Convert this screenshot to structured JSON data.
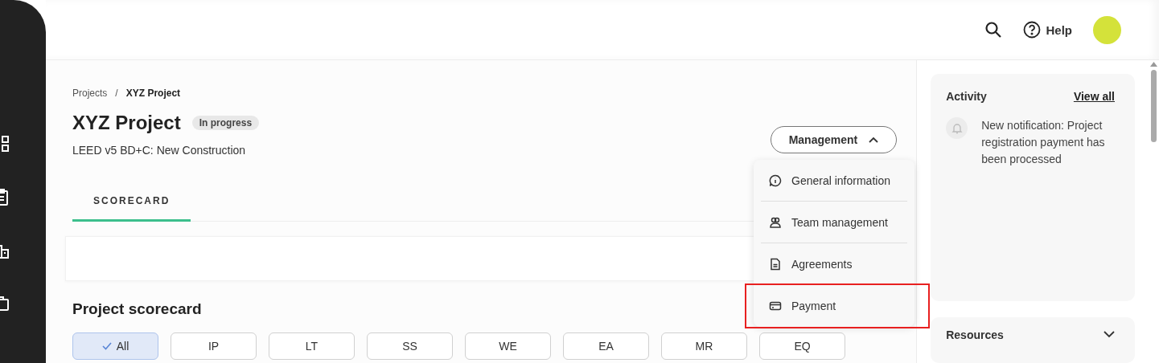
{
  "header": {
    "help": "Help"
  },
  "breadcrumb": [
    {
      "label": "Projects",
      "current": false
    },
    {
      "separator": "/",
      "label": "XYZ Project",
      "current": true
    }
  ],
  "project": {
    "title": "XYZ Project",
    "status": "In progress",
    "subtitle": "LEED v5 BD+C: New Construction"
  },
  "tabs": [
    {
      "label": "SCORECARD",
      "selected": true
    }
  ],
  "management": {
    "label": "Management",
    "expanded": true,
    "items": [
      {
        "label": "General information",
        "kind": "info",
        "highlighted": false
      },
      {
        "label": "Team management",
        "kind": "team",
        "highlighted": false
      },
      {
        "label": "Agreements",
        "kind": "document",
        "highlighted": false
      },
      {
        "label": "Payment",
        "kind": "card",
        "highlighted": true
      }
    ]
  },
  "scorecard": {
    "title": "Project scorecard",
    "filters": [
      {
        "label": "All",
        "selected": true
      },
      {
        "label": "IP",
        "selected": false
      },
      {
        "label": "LT",
        "selected": false
      },
      {
        "label": "SS",
        "selected": false
      },
      {
        "label": "WE",
        "selected": false
      },
      {
        "label": "EA",
        "selected": false
      },
      {
        "label": "MR",
        "selected": false
      },
      {
        "label": "EQ",
        "selected": false
      }
    ]
  },
  "activity": {
    "title": "Activity",
    "link": "View all",
    "notifications": [
      "New notification: Project registration payment has been processed"
    ]
  },
  "resources": {
    "title": "Resources",
    "expanded": false
  }
}
